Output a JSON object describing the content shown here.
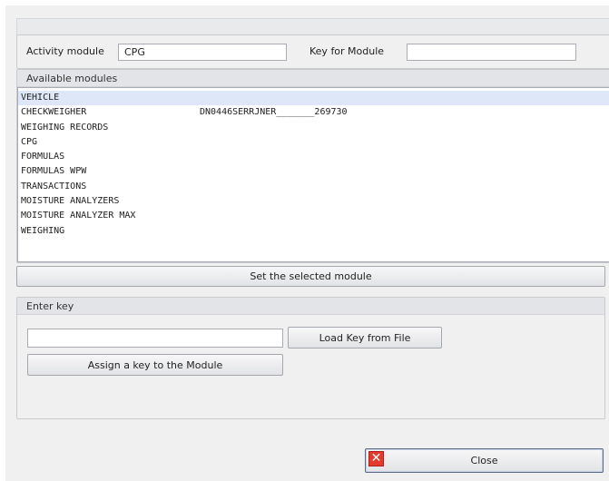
{
  "activity": {
    "label": "Activity module",
    "value": "CPG",
    "key_label": "Key for Module",
    "key_value": ""
  },
  "modules": {
    "title": "Available modules",
    "items": [
      {
        "name": "VEHICLE",
        "detail": "",
        "selected": true
      },
      {
        "name": "CHECKWEIGHER",
        "detail": "DN0446SERRJNER_______269730",
        "selected": false
      },
      {
        "name": "WEIGHING RECORDS",
        "detail": "",
        "selected": false
      },
      {
        "name": "CPG",
        "detail": "",
        "selected": false
      },
      {
        "name": "FORMULAS",
        "detail": "",
        "selected": false
      },
      {
        "name": "FORMULAS WPW",
        "detail": "",
        "selected": false
      },
      {
        "name": "TRANSACTIONS",
        "detail": "",
        "selected": false
      },
      {
        "name": "MOISTURE ANALYZERS",
        "detail": "",
        "selected": false
      },
      {
        "name": "MOISTURE ANALYZER MAX",
        "detail": "",
        "selected": false
      },
      {
        "name": "WEIGHING",
        "detail": "",
        "selected": false
      }
    ],
    "set_button": "Set the selected module"
  },
  "enter_key": {
    "title": "Enter key",
    "input_value": "",
    "load_button": "Load Key from File",
    "assign_button": "Assign a key to the Module"
  },
  "footer": {
    "close_button": "Close",
    "close_icon_glyph": "✕"
  },
  "colors": {
    "selection": "#dde7f7",
    "close_icon": "#e33b2d"
  }
}
